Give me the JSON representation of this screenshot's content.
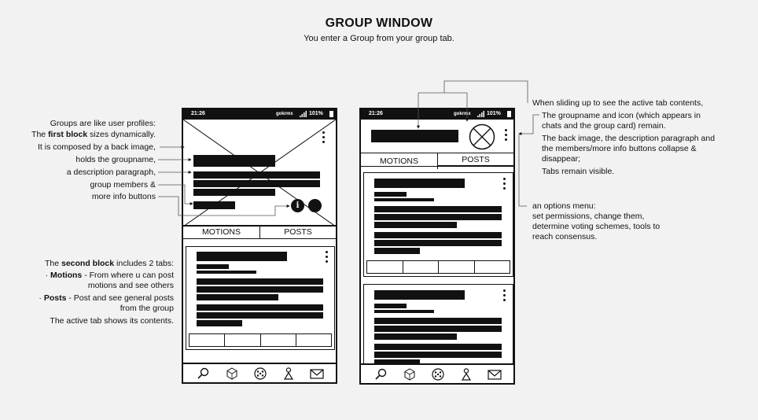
{
  "header": {
    "title": "GROUP WINDOW",
    "subtitle": "You enter a Group from your group tab."
  },
  "left_notes": {
    "intro_line1": "Groups are like user profiles:",
    "intro_line2_pre": "The ",
    "intro_line2_bold": "first block",
    "intro_line2_post": " sizes dynamically.",
    "back_image": "It is composed by a back image,",
    "groupname": "holds the groupname,",
    "description": "a description paragraph,",
    "members": "group members &",
    "more_info": "more info buttons",
    "second_pre": "The ",
    "second_bold": "second block",
    "second_post": " includes 2 tabs:",
    "motions_pre": "· ",
    "motions_bold": "Motions",
    "motions_post": " - From where u can post",
    "motions_line2": "motions and see others",
    "posts_pre": "· ",
    "posts_bold": "Posts",
    "posts_post": " - Post and see general posts",
    "posts_line2": "from the group",
    "active_tab": "The active tab shows its contents."
  },
  "right_notes": {
    "sliding": "When sliding up to see the active tab contents,",
    "groupname_icon_1": "The groupname and icon (which appears in",
    "groupname_icon_2": "chats and the group card) remain.",
    "collapse_1": "The back image, the description paragraph and",
    "collapse_2": "the members/more info buttons collapse &",
    "collapse_3": "disappear;",
    "tabs_visible": "Tabs remain visible.",
    "options_1": "an options menu:",
    "options_2": "set permissions, change them,",
    "options_3": "determine voting schemes, tools to",
    "options_4": "reach consensus."
  },
  "phone": {
    "time": "21:26",
    "carrier": "gokrmx",
    "battery": "101%",
    "tab_motions": "MOTIONS",
    "tab_posts": "POSTS",
    "info_glyph": "i"
  },
  "icons": {
    "nav": [
      "search-icon",
      "cube-icon",
      "dice-icon",
      "person-icon",
      "mail-icon"
    ],
    "menu": "more-vertical-icon",
    "group_icon": "group-avatar-x-icon"
  }
}
